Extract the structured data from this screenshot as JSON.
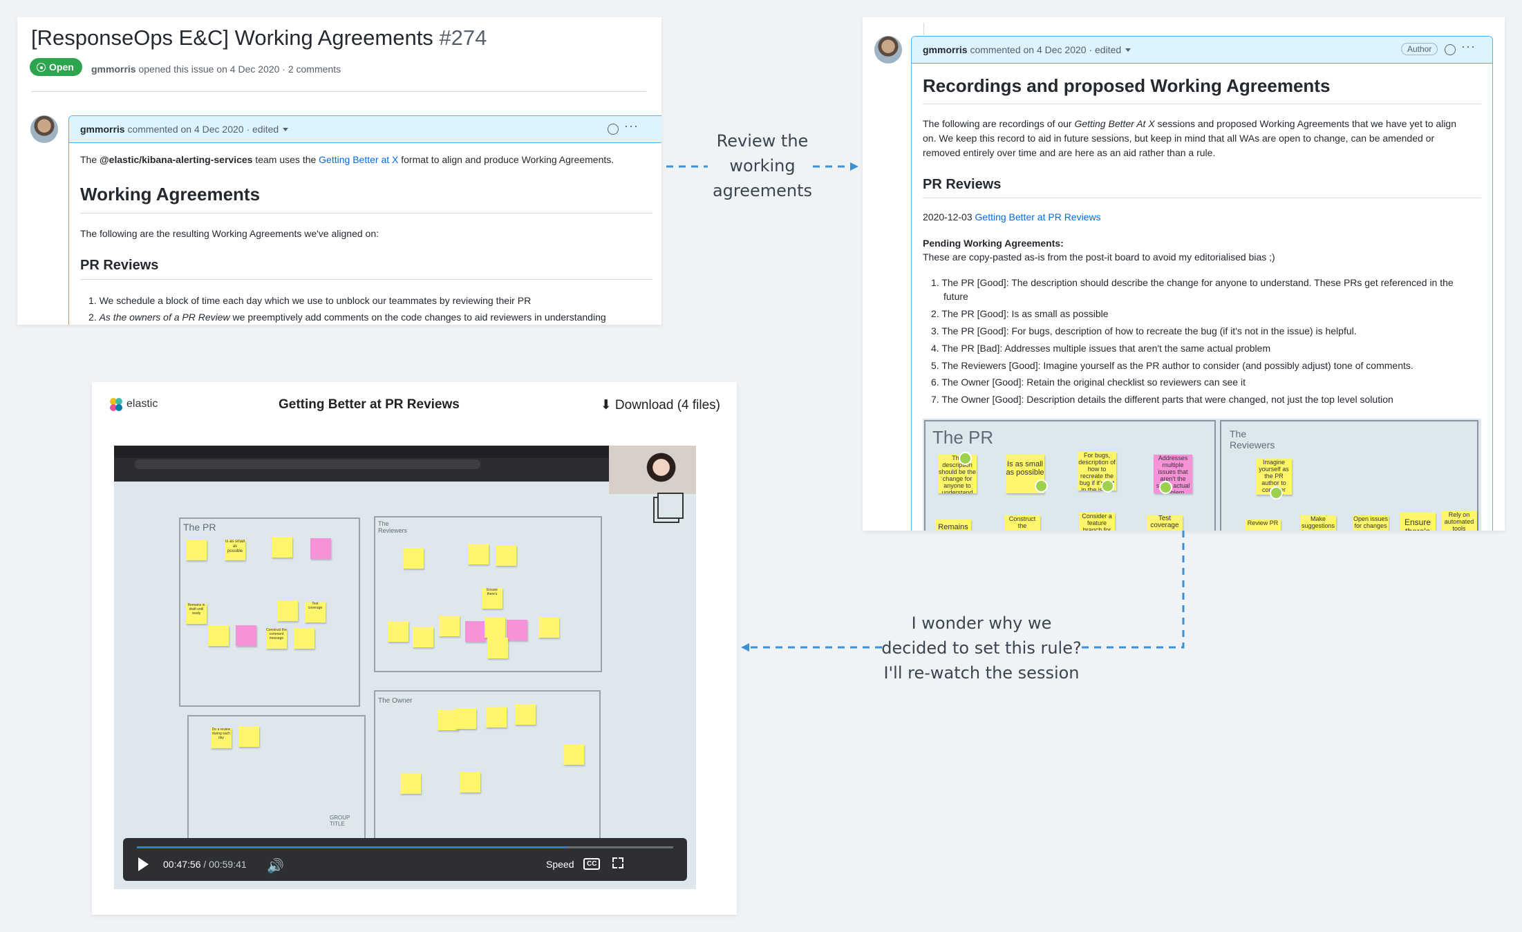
{
  "issue": {
    "title": "[ResponseOps E&C] Working Agreements",
    "number": "#274",
    "status": "Open",
    "author": "gmmorris",
    "meta": " opened this issue on 4 Dec 2020 · 2 comments",
    "comment": {
      "author": "gmmorris",
      "meta": " commented on 4 Dec 2020 · edited",
      "intro_pre": "The ",
      "team": "@elastic/kibana-alerting-services",
      "intro_mid": " team uses the ",
      "intro_link": "Getting Better at X",
      "intro_post": " format to align and produce Working Agreements.",
      "heading": "Working Agreements",
      "sub": "The following are the resulting Working Agreements we've aligned on:",
      "section": "PR Reviews",
      "items": [
        "We schedule a block of time each day which we use to unblock our teammates by reviewing their PR",
        "As the owners of a PR Review we preemptively add comments on the code changes to aid reviewers in understanding"
      ],
      "item2_em": "As the owners of a PR Review",
      "item2_rest": " we preemptively add comments on the code changes to aid reviewers in understanding"
    }
  },
  "recording": {
    "author": "gmmorris",
    "meta": " commented on 4 Dec 2020 · edited",
    "badge": "Author",
    "heading": "Recordings and proposed Working Agreements",
    "p1_pre": "The following are recordings of our ",
    "p1_em": "Getting Better At X",
    "p1_post": " sessions and proposed Working Agreements that we have yet to align",
    "p2": "on. We keep this record to aid in future sessions, but keep in mind that all WAs are open to change, can be amended or",
    "p3": "removed entirely over time and are here as an aid rather than a rule.",
    "section": "PR Reviews",
    "date": "2020-12-03",
    "date_link": "Getting Better at PR Reviews",
    "pending_title": "Pending Working Agreements:",
    "pending_sub": "These are copy-pasted as-is from the post-it board to avoid my editorialised bias ;)",
    "items": [
      "The PR [Good]: The description should describe the change for anyone to understand. These PRs get referenced in the",
      "The PR [Good]: Is as small as possible",
      "The PR [Good]: For bugs, description of how to recreate the bug (if it's not in the issue) is helpful.",
      "The PR [Bad]: Addresses multiple issues that aren't the same actual problem",
      "The Reviewers [Good]: Imagine yourself as the PR author to consider (and possibly adjust) tone of comments.",
      "The Owner [Good]: Retain the original checklist so reviewers can see it",
      "The Owner [Good]: Description details the different parts that were changed, not just the top level solution"
    ],
    "item1_cont": "future",
    "board": {
      "pr_label": "The PR",
      "reviewers_label": "The Reviewers",
      "stickies": [
        "The description should be the change for anyone to understand",
        "Is as small as possible",
        "For bugs, description of how to recreate the bug if it's not in the issue",
        "Addresses multiple issues that aren't the same actual problem",
        "Imagine yourself as the PR author to consider tone of comments",
        "Remains",
        "Construct the comment message",
        "Consider a feature branch for",
        "Test coverage",
        "Review PR",
        "Make suggestions for alternate",
        "Open issues for changes",
        "Ensure there's",
        "Rely on automated tools"
      ]
    }
  },
  "video": {
    "brand": "elastic",
    "title": "Getting Better at PR Reviews",
    "download": "Download (4 files)",
    "time_current": "00:47:56",
    "time_sep": " / ",
    "time_total": "00:59:41",
    "speed": "Speed",
    "cc": "CC",
    "progress": 0.8,
    "board": {
      "pr": "The PR",
      "reviewers": "The Reviewers",
      "owner": "The Owner",
      "group": "GROUP TITLE",
      "stickies": [
        "Is as small as possible",
        "Remains in draft until ready",
        "Construct the comment message",
        "Test coverage",
        "Ensure there's",
        "Do a review during each day"
      ]
    }
  },
  "annotations": {
    "review": [
      "Review the",
      "working",
      "agreements"
    ],
    "wonder": [
      "I wonder why we",
      "decided to set this rule?",
      "I'll re-watch the session"
    ]
  },
  "colors": {
    "accent": "#0969da",
    "open": "#2da44e",
    "arrow": "#3d8fd6"
  }
}
